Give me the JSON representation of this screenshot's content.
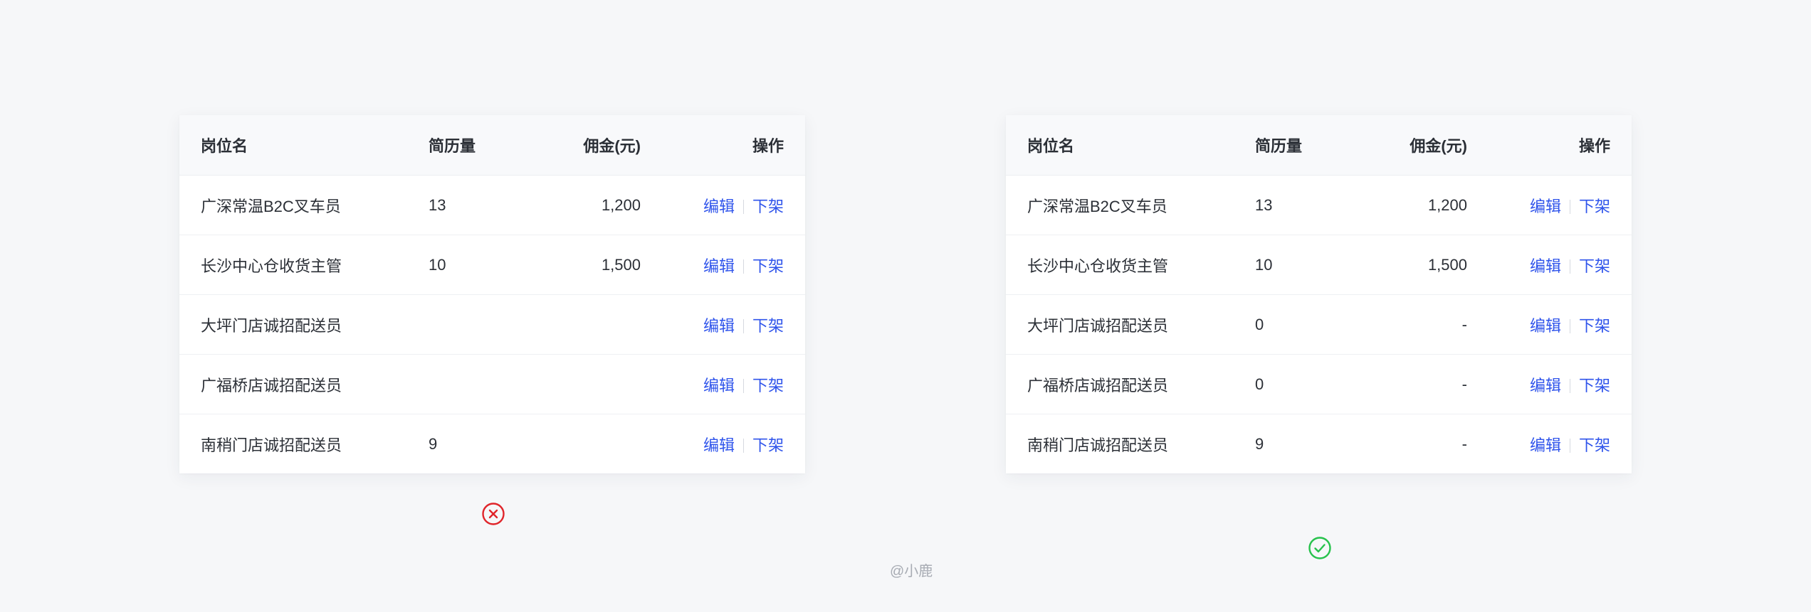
{
  "columns": {
    "name": "岗位名",
    "resume_count": "简历量",
    "commission": "佣金(元)",
    "actions": "操作"
  },
  "actions": {
    "edit": "编辑",
    "delist": "下架"
  },
  "left_table": {
    "rows": [
      {
        "name": "广深常温B2C叉车员",
        "count": "13",
        "commission": "1,200"
      },
      {
        "name": "长沙中心仓收货主管",
        "count": "10",
        "commission": "1,500"
      },
      {
        "name": "大坪门店诚招配送员",
        "count": "",
        "commission": ""
      },
      {
        "name": "广福桥店诚招配送员",
        "count": "",
        "commission": ""
      },
      {
        "name": "南稍门店诚招配送员",
        "count": "9",
        "commission": ""
      }
    ]
  },
  "right_table": {
    "rows": [
      {
        "name": "广深常温B2C叉车员",
        "count": "13",
        "commission": "1,200"
      },
      {
        "name": "长沙中心仓收货主管",
        "count": "10",
        "commission": "1,500"
      },
      {
        "name": "大坪门店诚招配送员",
        "count": "0",
        "commission": "-"
      },
      {
        "name": "广福桥店诚招配送员",
        "count": "0",
        "commission": "-"
      },
      {
        "name": "南稍门店诚招配送员",
        "count": "9",
        "commission": "-"
      }
    ]
  },
  "icons": {
    "wrong": "close-circle-icon",
    "correct": "check-circle-icon"
  },
  "colors": {
    "link": "#2f54eb",
    "wrong": "#e0252b",
    "correct": "#27c24c"
  },
  "watermark": "@小鹿"
}
